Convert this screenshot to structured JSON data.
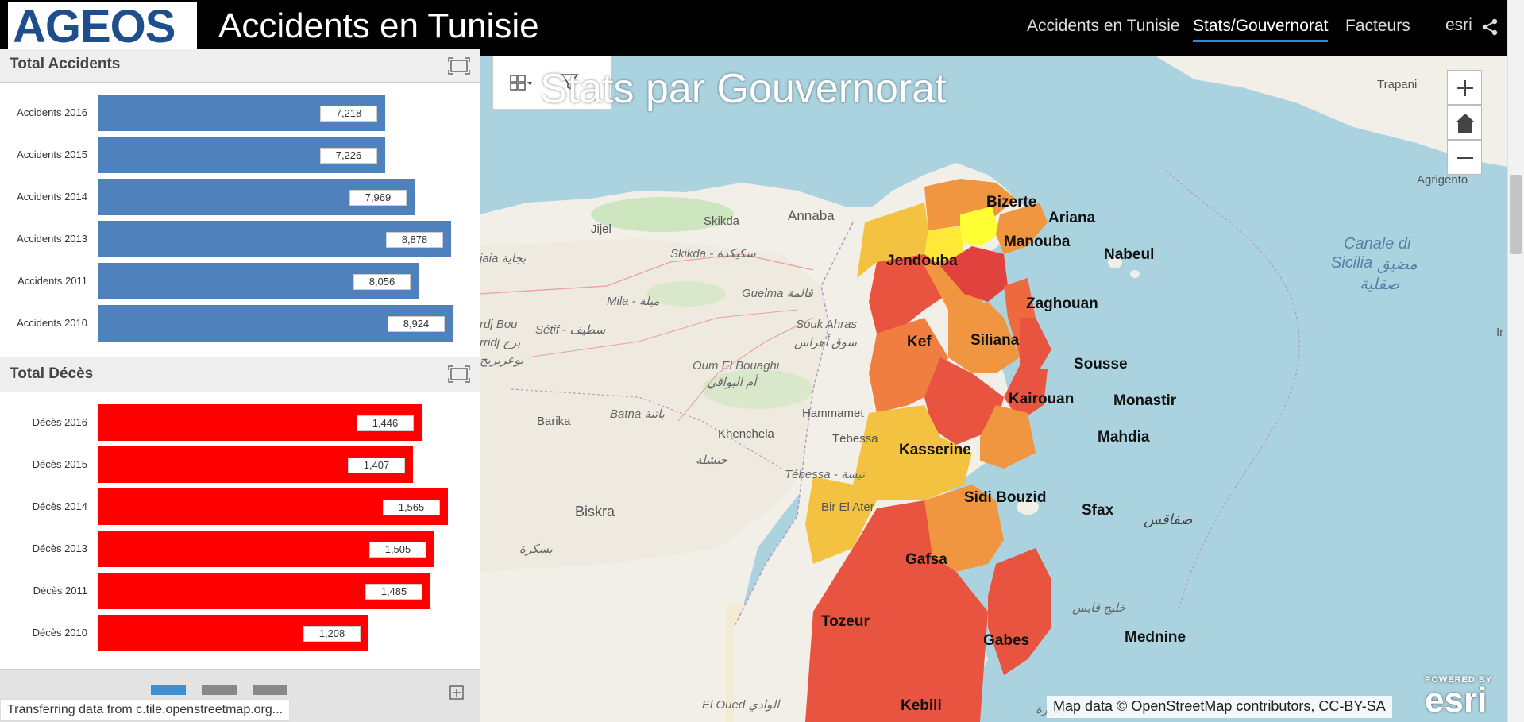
{
  "header": {
    "logo": "AGEOS",
    "title": "Accidents en Tunisie",
    "nav": [
      {
        "label": "Accidents en Tunisie"
      },
      {
        "label": "Stats/Gouvernorat"
      },
      {
        "label": "Facteurs"
      }
    ],
    "esri_label": "esri"
  },
  "panels": {
    "accidents": {
      "title": "Total Accidents",
      "bar_color": "#4f81bd",
      "rows": [
        {
          "label": "Accidents 2016",
          "value": 7218,
          "display": "7,218"
        },
        {
          "label": "Accidents 2015",
          "value": 7226,
          "display": "7,226"
        },
        {
          "label": "Accidents 2014",
          "value": 7969,
          "display": "7,969"
        },
        {
          "label": "Accidents 2013",
          "value": 8878,
          "display": "8,878"
        },
        {
          "label": "Accidents 2011",
          "value": 8056,
          "display": "8,056"
        },
        {
          "label": "Accidents 2010",
          "value": 8924,
          "display": "8,924"
        }
      ]
    },
    "deces": {
      "title": "Total Décès",
      "bar_color": "#ff0000",
      "rows": [
        {
          "label": "Décès 2016",
          "value": 1446,
          "display": "1,446"
        },
        {
          "label": "Décès 2015",
          "value": 1407,
          "display": "1,407"
        },
        {
          "label": "Décès 2014",
          "value": 1565,
          "display": "1,565"
        },
        {
          "label": "Décès 2013",
          "value": 1505,
          "display": "1,505"
        },
        {
          "label": "Décès 2011",
          "value": 1485,
          "display": "1,485"
        },
        {
          "label": "Décès 2010",
          "value": 1208,
          "display": "1,208"
        }
      ]
    }
  },
  "status": "Transferring data from c.tile.openstreetmap.org...",
  "map": {
    "title": "Stats par Gouvernorat",
    "attribution": "Map data © OpenStreetMap contributors, CC-BY-SA",
    "powered_by": "POWERED BY",
    "esri_logo": "esri",
    "governorates": [
      "Bizerte",
      "Ariana",
      "Manouba",
      "Nabeul",
      "Jendouba",
      "Zaghouan",
      "Kef",
      "Siliana",
      "Sousse",
      "Monastir",
      "Kairouan",
      "Mahdia",
      "Kasserine",
      "Sidi Bouzid",
      "Sfax",
      "Gafsa",
      "Tozeur",
      "Gabes",
      "Mednine",
      "Kebili"
    ],
    "places": [
      "Trapani",
      "Agrigento",
      "Canale di",
      "Sicilia",
      "مضيق",
      "صقلية",
      "Ir",
      "Annaba",
      "Skikda",
      "Jijel",
      "Skikda - سكيكدة",
      "Guelma قالمة",
      "Mila - ميلة",
      "Sétif - سطيف",
      "Souk Ahras",
      "سوق أهراس",
      "Oum El Bouaghi",
      "أم البواقي",
      "Batna باتنة",
      "Barika",
      "Khenchela",
      "خنشلة",
      "Hammamet",
      "Tébessa",
      "Tébessa - تبسة",
      "Bir El Ater",
      "Biskra",
      "El Oued الوادي",
      "بسكرة",
      "صفاقس",
      "خليج قابس",
      "الجزيرة",
      "rdj Bou",
      "rridj برج",
      "بوعريريج",
      "jaia بجاية",
      "Khenchela"
    ]
  }
}
